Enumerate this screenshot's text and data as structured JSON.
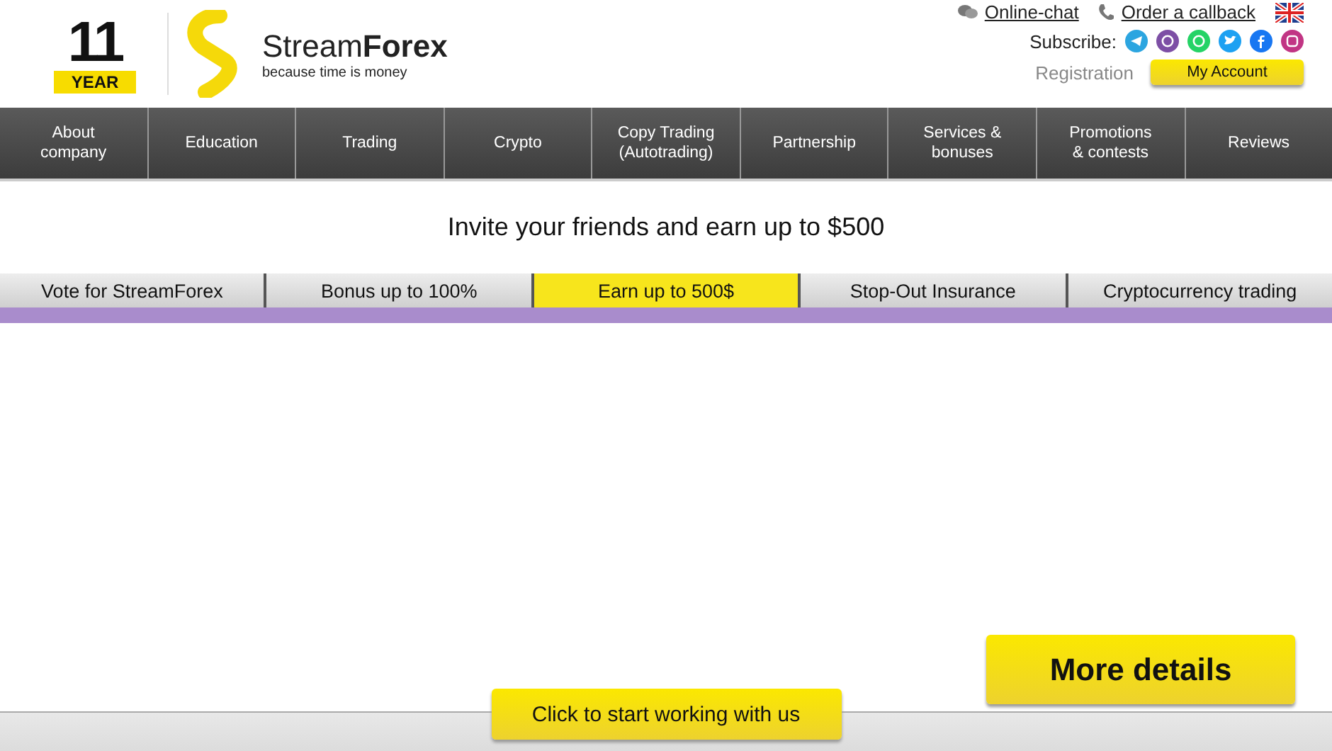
{
  "logo": {
    "years": "11",
    "badge": "YEAR",
    "brand": "Stream**Forex**",
    "tagline": "because time is money"
  },
  "top_links": [
    {
      "kind": "chat",
      "label": "Online-chat"
    },
    {
      "kind": "phone",
      "label": "Order a callback"
    }
  ],
  "subscribe": {
    "label": "Subscribe:",
    "channels": [
      {
        "kind": "telegram",
        "color": "#2ca5e0"
      },
      {
        "kind": "viber",
        "color": "#7d4fa5"
      },
      {
        "kind": "whatsapp",
        "color": "#25d366"
      },
      {
        "kind": "twitter",
        "color": "#1da1f2"
      },
      {
        "kind": "facebook",
        "color": "#1877f2"
      },
      {
        "kind": "instagram",
        "color": "#c13584"
      }
    ]
  },
  "registration": "Registration",
  "account_button": "My Account",
  "nav": [
    "About\ncompany",
    "Education",
    "Trading",
    "Crypto",
    "Copy Trading\n(Autotrading)",
    "Partnership",
    "Services &\nbonuses",
    "Promotions\n& contests",
    "Reviews"
  ],
  "heading": "Invite your friends and earn up to $500",
  "tabs": [
    {
      "label": "Vote for StreamForex",
      "selected": false
    },
    {
      "label": "Bonus up to 100%",
      "selected": false
    },
    {
      "label": "Earn up to 500$",
      "selected": true
    },
    {
      "label": "Stop-Out Insurance",
      "selected": false
    },
    {
      "label": "Cryptocurrency trading",
      "selected": false
    }
  ],
  "details_button": "More details",
  "start_button": "Click to start working with us"
}
